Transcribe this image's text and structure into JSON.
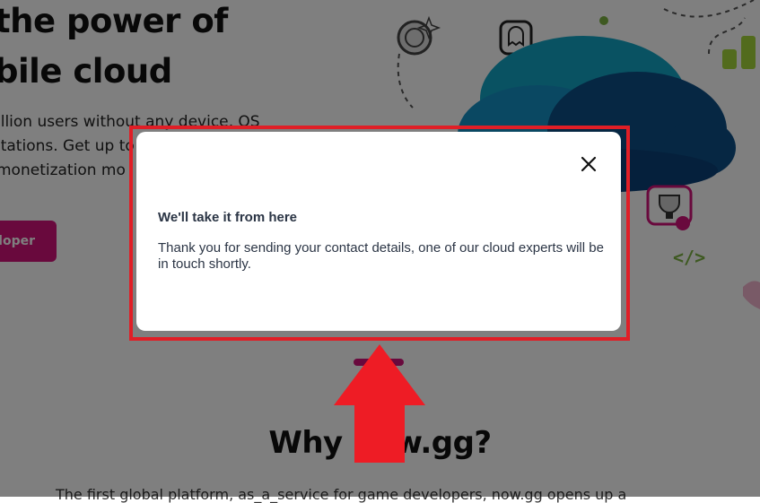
{
  "hero": {
    "title_line1": "the power of",
    "title_line2": "bile cloud",
    "text_line1": "illion users without any device, OS",
    "text_line2": "itations. Get up to",
    "text_line3": "monetization mo",
    "cta_label": "loper"
  },
  "section": {
    "title": "Why now.gg?",
    "text": "The first global platform, as_a_service for game developers, now.gg opens up a"
  },
  "modal": {
    "heading": "We'll take it from here",
    "body": "Thank you for sending your contact details, one of our cloud experts will be in touch shortly.",
    "close_icon": "close-icon"
  },
  "annotation": {
    "box_color": "#e01e26",
    "arrow_color": "#ee1c25",
    "arrow_direction": "up"
  },
  "colors": {
    "brand": "#d2127a",
    "overlay": "rgba(0,0,0,0.5)",
    "cloud_dark": "#0c4f86",
    "cloud_light": "#13a4c4"
  }
}
